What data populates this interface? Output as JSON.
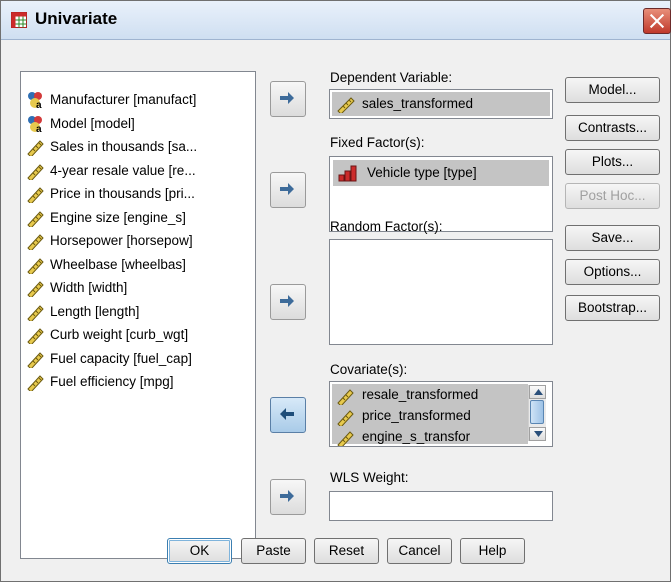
{
  "window": {
    "title": "Univariate"
  },
  "variables": [
    {
      "label": "Manufacturer [manufact]",
      "icon": "nominal-icon"
    },
    {
      "label": "Model [model]",
      "icon": "nominal-icon"
    },
    {
      "label": "Sales in thousands [sa...",
      "icon": "scale-icon"
    },
    {
      "label": "4-year resale value [re...",
      "icon": "scale-icon"
    },
    {
      "label": "Price in thousands [pri...",
      "icon": "scale-icon"
    },
    {
      "label": "Engine size [engine_s]",
      "icon": "scale-icon"
    },
    {
      "label": "Horsepower [horsepow]",
      "icon": "scale-icon"
    },
    {
      "label": "Wheelbase [wheelbas]",
      "icon": "scale-icon"
    },
    {
      "label": "Width [width]",
      "icon": "scale-icon"
    },
    {
      "label": "Length [length]",
      "icon": "scale-icon"
    },
    {
      "label": "Curb weight [curb_wgt]",
      "icon": "scale-icon"
    },
    {
      "label": "Fuel capacity [fuel_cap]",
      "icon": "scale-icon"
    },
    {
      "label": "Fuel efficiency [mpg]",
      "icon": "scale-icon"
    }
  ],
  "dependent": {
    "label": "Dependent Variable:",
    "value": "sales_transformed"
  },
  "fixed": {
    "label": "Fixed Factor(s):",
    "value": "Vehicle type [type]"
  },
  "random": {
    "label": "Random Factor(s):"
  },
  "covariates": {
    "label": "Covariate(s):",
    "items": [
      "resale_transformed",
      "price_transformed",
      "engine_s_transfor"
    ]
  },
  "wls": {
    "label": "WLS Weight:"
  },
  "side_buttons": [
    "Model...",
    "Contrasts...",
    "Plots...",
    "Post Hoc...",
    "Save...",
    "Options...",
    "Bootstrap..."
  ],
  "bottom_buttons": [
    "OK",
    "Paste",
    "Reset",
    "Cancel",
    "Help"
  ],
  "colors": {
    "titlebar": "#cfdff1",
    "selection": "#c4c4c4",
    "active_arrow": "#a9cbe8"
  }
}
